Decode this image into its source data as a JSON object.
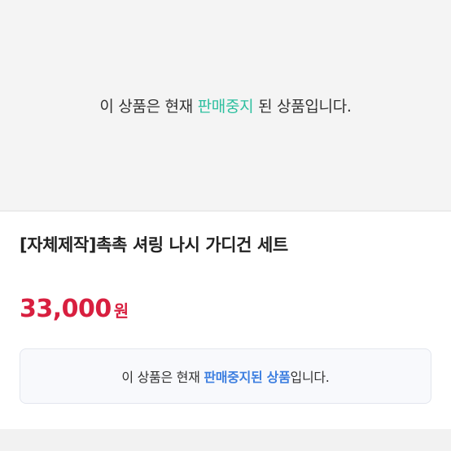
{
  "banner": {
    "prefix": "이 상품은 현재 ",
    "highlight": "판매중지",
    "suffix": " 된 상품입니다."
  },
  "product": {
    "title": "[자체제작]촉촉 셔링 나시 가디건 세트",
    "price": "33,000",
    "price_unit": "원"
  },
  "notice": {
    "prefix": "이 상품은 현재 ",
    "highlight": "판매중지된 상품",
    "suffix": "입니다."
  },
  "colors": {
    "banner_highlight": "#2dbf9f",
    "price": "#d81f3f",
    "notice_highlight": "#3d7fe0"
  }
}
